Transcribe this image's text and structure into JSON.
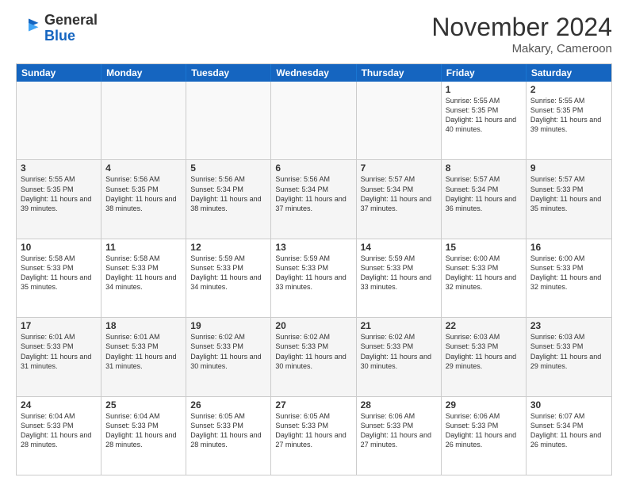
{
  "logo": {
    "general": "General",
    "blue": "Blue"
  },
  "header": {
    "month": "November 2024",
    "location": "Makary, Cameroon"
  },
  "days": [
    "Sunday",
    "Monday",
    "Tuesday",
    "Wednesday",
    "Thursday",
    "Friday",
    "Saturday"
  ],
  "rows": [
    [
      {
        "day": "",
        "empty": true
      },
      {
        "day": "",
        "empty": true
      },
      {
        "day": "",
        "empty": true
      },
      {
        "day": "",
        "empty": true
      },
      {
        "day": "",
        "empty": true
      },
      {
        "day": "1",
        "sunrise": "5:55 AM",
        "sunset": "5:35 PM",
        "daylight": "11 hours and 40 minutes."
      },
      {
        "day": "2",
        "sunrise": "5:55 AM",
        "sunset": "5:35 PM",
        "daylight": "11 hours and 39 minutes."
      }
    ],
    [
      {
        "day": "3",
        "sunrise": "5:55 AM",
        "sunset": "5:35 PM",
        "daylight": "11 hours and 39 minutes."
      },
      {
        "day": "4",
        "sunrise": "5:56 AM",
        "sunset": "5:35 PM",
        "daylight": "11 hours and 38 minutes."
      },
      {
        "day": "5",
        "sunrise": "5:56 AM",
        "sunset": "5:34 PM",
        "daylight": "11 hours and 38 minutes."
      },
      {
        "day": "6",
        "sunrise": "5:56 AM",
        "sunset": "5:34 PM",
        "daylight": "11 hours and 37 minutes."
      },
      {
        "day": "7",
        "sunrise": "5:57 AM",
        "sunset": "5:34 PM",
        "daylight": "11 hours and 37 minutes."
      },
      {
        "day": "8",
        "sunrise": "5:57 AM",
        "sunset": "5:34 PM",
        "daylight": "11 hours and 36 minutes."
      },
      {
        "day": "9",
        "sunrise": "5:57 AM",
        "sunset": "5:33 PM",
        "daylight": "11 hours and 35 minutes."
      }
    ],
    [
      {
        "day": "10",
        "sunrise": "5:58 AM",
        "sunset": "5:33 PM",
        "daylight": "11 hours and 35 minutes."
      },
      {
        "day": "11",
        "sunrise": "5:58 AM",
        "sunset": "5:33 PM",
        "daylight": "11 hours and 34 minutes."
      },
      {
        "day": "12",
        "sunrise": "5:59 AM",
        "sunset": "5:33 PM",
        "daylight": "11 hours and 34 minutes."
      },
      {
        "day": "13",
        "sunrise": "5:59 AM",
        "sunset": "5:33 PM",
        "daylight": "11 hours and 33 minutes."
      },
      {
        "day": "14",
        "sunrise": "5:59 AM",
        "sunset": "5:33 PM",
        "daylight": "11 hours and 33 minutes."
      },
      {
        "day": "15",
        "sunrise": "6:00 AM",
        "sunset": "5:33 PM",
        "daylight": "11 hours and 32 minutes."
      },
      {
        "day": "16",
        "sunrise": "6:00 AM",
        "sunset": "5:33 PM",
        "daylight": "11 hours and 32 minutes."
      }
    ],
    [
      {
        "day": "17",
        "sunrise": "6:01 AM",
        "sunset": "5:33 PM",
        "daylight": "11 hours and 31 minutes."
      },
      {
        "day": "18",
        "sunrise": "6:01 AM",
        "sunset": "5:33 PM",
        "daylight": "11 hours and 31 minutes."
      },
      {
        "day": "19",
        "sunrise": "6:02 AM",
        "sunset": "5:33 PM",
        "daylight": "11 hours and 30 minutes."
      },
      {
        "day": "20",
        "sunrise": "6:02 AM",
        "sunset": "5:33 PM",
        "daylight": "11 hours and 30 minutes."
      },
      {
        "day": "21",
        "sunrise": "6:02 AM",
        "sunset": "5:33 PM",
        "daylight": "11 hours and 30 minutes."
      },
      {
        "day": "22",
        "sunrise": "6:03 AM",
        "sunset": "5:33 PM",
        "daylight": "11 hours and 29 minutes."
      },
      {
        "day": "23",
        "sunrise": "6:03 AM",
        "sunset": "5:33 PM",
        "daylight": "11 hours and 29 minutes."
      }
    ],
    [
      {
        "day": "24",
        "sunrise": "6:04 AM",
        "sunset": "5:33 PM",
        "daylight": "11 hours and 28 minutes."
      },
      {
        "day": "25",
        "sunrise": "6:04 AM",
        "sunset": "5:33 PM",
        "daylight": "11 hours and 28 minutes."
      },
      {
        "day": "26",
        "sunrise": "6:05 AM",
        "sunset": "5:33 PM",
        "daylight": "11 hours and 28 minutes."
      },
      {
        "day": "27",
        "sunrise": "6:05 AM",
        "sunset": "5:33 PM",
        "daylight": "11 hours and 27 minutes."
      },
      {
        "day": "28",
        "sunrise": "6:06 AM",
        "sunset": "5:33 PM",
        "daylight": "11 hours and 27 minutes."
      },
      {
        "day": "29",
        "sunrise": "6:06 AM",
        "sunset": "5:33 PM",
        "daylight": "11 hours and 26 minutes."
      },
      {
        "day": "30",
        "sunrise": "6:07 AM",
        "sunset": "5:34 PM",
        "daylight": "11 hours and 26 minutes."
      }
    ]
  ],
  "labels": {
    "sunrise": "Sunrise:",
    "sunset": "Sunset:",
    "daylight": "Daylight hours"
  }
}
